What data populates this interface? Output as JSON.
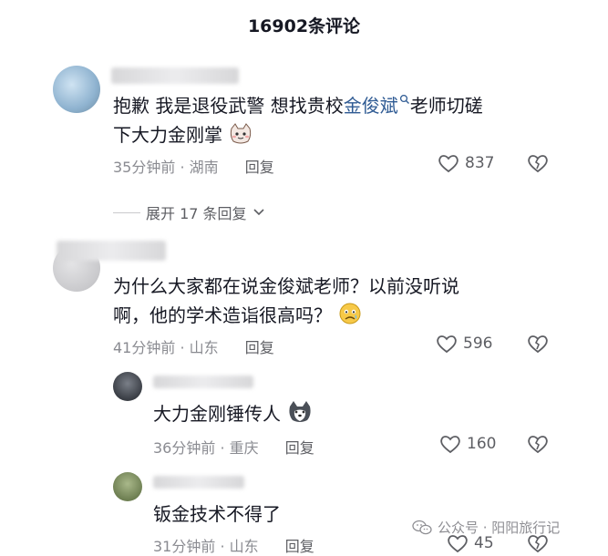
{
  "header": {
    "title": "16902条评论"
  },
  "comments": [
    {
      "text_before": "抱歉 我是退役武警 想找贵校",
      "mention": "金俊斌",
      "text_after": "老师切磋",
      "text_line2": "下大力金刚掌",
      "time": "35分钟前",
      "location": "湖南",
      "reply_label": "回复",
      "likes": "837",
      "expand_label": "展开 17 条回复"
    },
    {
      "text_line1": "为什么大家都在说金俊斌老师？以前没听说",
      "text_line2": "啊，他的学术造诣很高吗？",
      "time": "41分钟前",
      "location": "山东",
      "reply_label": "回复",
      "likes": "596"
    }
  ],
  "replies": [
    {
      "text": "大力金刚锤传人",
      "time": "36分钟前",
      "location": "重庆",
      "reply_label": "回复",
      "likes": "160"
    },
    {
      "text": "钣金技术不得了",
      "time": "31分钟前",
      "location": "山东",
      "reply_label": "回复",
      "likes": "45"
    }
  ],
  "watermark": {
    "text": "公众号 · 阳阳旅行记"
  },
  "icons": {
    "like": "heart-outline-icon",
    "dislike": "broken-heart-icon",
    "search": "search-icon",
    "expand": "chevron-down-icon",
    "wechat": "wechat-icon"
  }
}
